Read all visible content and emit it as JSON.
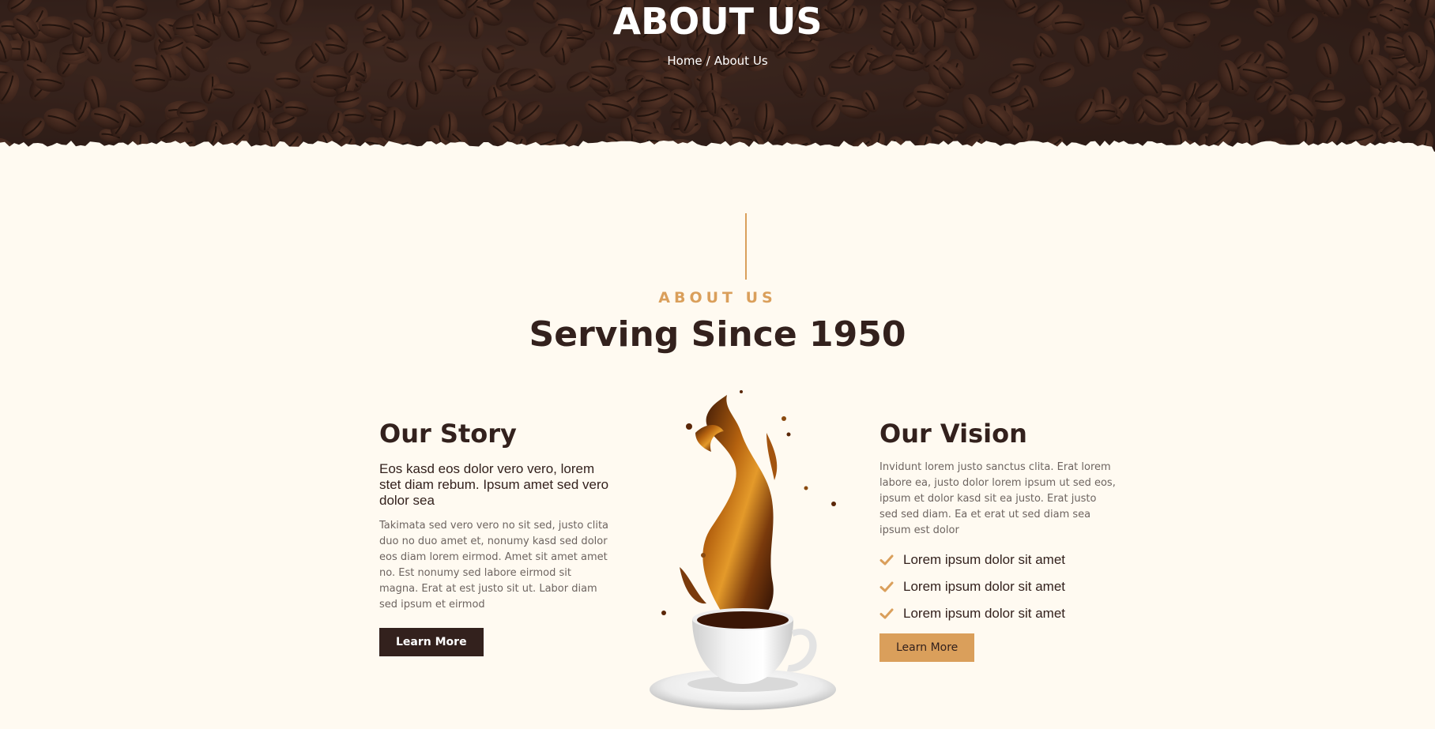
{
  "hero": {
    "title": "ABOUT US",
    "breadcrumb": {
      "home": "Home",
      "separator": "/",
      "current": "About Us"
    }
  },
  "section": {
    "eyebrow": "ABOUT US",
    "title": "Serving Since 1950"
  },
  "story": {
    "title": "Our Story",
    "lead": "Eos kasd eos dolor vero vero, lorem stet diam rebum. Ipsum amet sed vero dolor sea",
    "body": "Takimata sed vero vero no sit sed, justo clita duo no duo amet et, nonumy kasd sed dolor eos diam lorem eirmod. Amet sit amet amet no. Est nonumy sed labore eirmod sit magna. Erat at est justo sit ut. Labor diam sed ipsum et eirmod",
    "button_label": "Learn More"
  },
  "vision": {
    "title": "Our Vision",
    "body": "Invidunt lorem justo sanctus clita. Erat lorem labore ea, justo dolor lorem ipsum ut sed eos, ipsum et dolor kasd sit ea justo. Erat justo sed sed diam. Ea et erat ut sed diam sea ipsum est dolor",
    "checklist": [
      "Lorem ipsum dolor sit amet",
      "Lorem ipsum dolor sit amet",
      "Lorem ipsum dolor sit amet"
    ],
    "button_label": "Learn More"
  },
  "colors": {
    "primary_dark": "#33211D",
    "accent_gold": "#DA9F5B",
    "background": "#FFFAF1"
  },
  "icons": {
    "check": "check-icon",
    "hero_background": "coffee-beans-image",
    "center_image": "coffee-splash-cup-image"
  }
}
